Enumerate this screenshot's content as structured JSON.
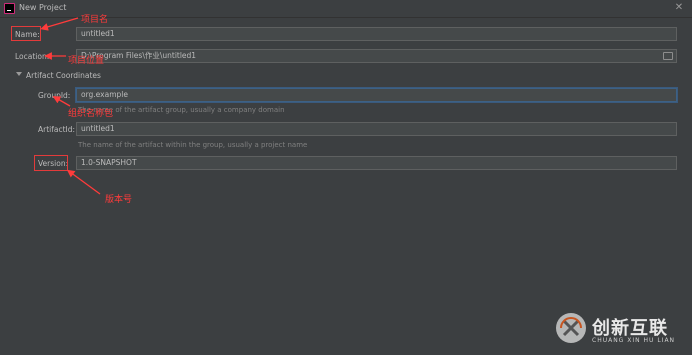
{
  "window": {
    "title": "New Project"
  },
  "form": {
    "name_label": "Name:",
    "name_value": "untitled1",
    "location_label": "Location:",
    "location_value": "D:\\Program Files\\作业\\untitled1",
    "section_label": "Artifact Coordinates",
    "groupid_label": "GroupId:",
    "groupid_value": "org.example",
    "groupid_hint": "The name of the artifact group, usually a company domain",
    "artifactid_label": "ArtifactId:",
    "artifactid_value": "untitled1",
    "artifactid_hint": "The name of the artifact within the group, usually a project name",
    "version_label": "Version:",
    "version_value": "1.0-SNAPSHOT"
  },
  "annotations": {
    "project_name": "项目名",
    "project_location": "项目位置",
    "group_package": "组织名称包",
    "version_number": "版本号"
  },
  "watermark": {
    "text": "创新互联",
    "subtext": "CHUANG XIN HU LIAN"
  },
  "colors": {
    "background": "#3c3f41",
    "field": "#45494a",
    "annotation": "#e33b3b",
    "focus": "#3d6185"
  },
  "icons": [
    "app-icon",
    "close-icon",
    "folder-icon",
    "chevron-down-icon"
  ]
}
